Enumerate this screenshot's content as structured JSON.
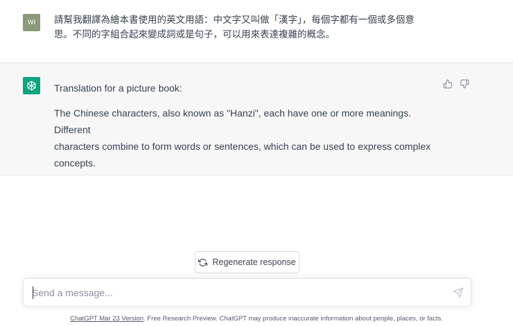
{
  "user_message": {
    "avatar_initials": "WI",
    "line1": "請幫我翻譯為繪本書使用的英文用語：中文字又叫做「漢字」，每個字都有一個或多個意",
    "line2": "思。不同的字組合起來變成詞或是句子，可以用來表達複雜的概念。"
  },
  "assistant_message": {
    "heading": "Translation for a picture book:",
    "body_line1": "The Chinese characters, also known as \"Hanzi\", each have one or more meanings. Different",
    "body_line2": "characters combine to form words or sentences, which can be used to express complex",
    "body_line3": "concepts."
  },
  "regenerate": {
    "label": "Regenerate response"
  },
  "composer": {
    "placeholder": "Send a message..."
  },
  "footer": {
    "version_link": "ChatGPT Mar 23 Version",
    "text": ". Free Research Preview. ChatGPT may produce inaccurate information about people, places, or facts."
  },
  "colors": {
    "user_avatar": "#8b9a79",
    "assistant_avatar": "#10a37f",
    "assistant_bg": "#f7f7f8"
  },
  "icons": [
    "openai-logo-icon",
    "thumbs-up-icon",
    "thumbs-down-icon",
    "refresh-icon",
    "send-icon"
  ]
}
